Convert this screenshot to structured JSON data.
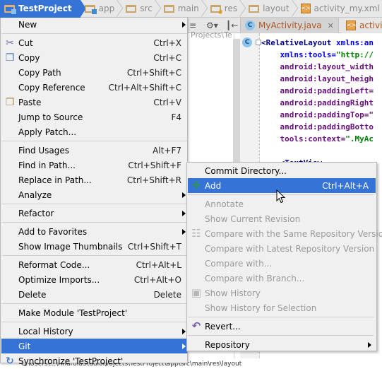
{
  "breadcrumb": [
    {
      "label": "TestProject",
      "icon": "module-folder-icon",
      "active": true
    },
    {
      "label": "app",
      "icon": "module-folder-icon"
    },
    {
      "label": "src",
      "icon": "folder-icon"
    },
    {
      "label": "main",
      "icon": "folder-icon"
    },
    {
      "label": "res",
      "icon": "resource-folder-icon"
    },
    {
      "label": "layout",
      "icon": "layout-folder-icon"
    },
    {
      "label": "activity_my.xml",
      "icon": "xml-file-icon"
    }
  ],
  "editor": {
    "tabs": [
      {
        "label": "MyActivity.java",
        "icon": "java-class-icon",
        "closable": true
      },
      {
        "label": "activity",
        "icon": "xml-file-icon"
      }
    ],
    "project_path": "Projects\\Te",
    "code_lines": [
      [
        {
          "t": "<RelativeLayout ",
          "c": "tagc"
        },
        {
          "t": "xmlns:an",
          "c": "attrb"
        }
      ],
      [
        {
          "t": "    xmlns:tools=",
          "c": "attrb"
        },
        {
          "t": "\"http://",
          "c": "str"
        }
      ],
      [
        {
          "t": "    android:layout_width",
          "c": "attr"
        }
      ],
      [
        {
          "t": "    android:layout_heigh",
          "c": "attr"
        }
      ],
      [
        {
          "t": "    android:paddingLeft=",
          "c": "attr"
        }
      ],
      [
        {
          "t": "    android:paddingRight",
          "c": "attr"
        }
      ],
      [
        {
          "t": "    android:paddingTop=\"",
          "c": "attr"
        }
      ],
      [
        {
          "t": "    android:paddingBotto",
          "c": "attr"
        }
      ],
      [
        {
          "t": "    tools:context=",
          "c": "attr"
        },
        {
          "t": "\".MyAc",
          "c": "str"
        }
      ],
      [
        {
          "t": "",
          "c": ""
        }
      ],
      [
        {
          "t": "    <TextView",
          "c": "tagc"
        }
      ]
    ]
  },
  "context_menu": {
    "items": [
      {
        "label": "New",
        "submenu": true
      },
      {
        "sep": true
      },
      {
        "label": "Cut",
        "shortcut": "Ctrl+X",
        "icon": "scissors-icon"
      },
      {
        "label": "Copy",
        "shortcut": "Ctrl+C",
        "icon": "copy-icon"
      },
      {
        "label": "Copy Path",
        "shortcut": "Ctrl+Shift+C"
      },
      {
        "label": "Copy Reference",
        "shortcut": "Ctrl+Alt+Shift+C"
      },
      {
        "label": "Paste",
        "shortcut": "Ctrl+V",
        "icon": "paste-icon"
      },
      {
        "label": "Jump to Source",
        "shortcut": "F4"
      },
      {
        "label": "Apply Patch..."
      },
      {
        "sep": true
      },
      {
        "label": "Find Usages",
        "shortcut": "Alt+F7"
      },
      {
        "label": "Find in Path...",
        "shortcut": "Ctrl+Shift+F"
      },
      {
        "label": "Replace in Path...",
        "shortcut": "Ctrl+Shift+R"
      },
      {
        "label": "Analyze",
        "submenu": true
      },
      {
        "sep": true
      },
      {
        "label": "Refactor",
        "submenu": true
      },
      {
        "sep": true
      },
      {
        "label": "Add to Favorites",
        "submenu": true
      },
      {
        "label": "Show Image Thumbnails",
        "shortcut": "Ctrl+Shift+T"
      },
      {
        "sep": true
      },
      {
        "label": "Reformat Code...",
        "shortcut": "Ctrl+Alt+L"
      },
      {
        "label": "Optimize Imports...",
        "shortcut": "Ctrl+Alt+O"
      },
      {
        "label": "Delete",
        "shortcut": "Delete"
      },
      {
        "sep": true
      },
      {
        "label": "Make Module 'TestProject'"
      },
      {
        "sep": true
      },
      {
        "label": "Local History",
        "submenu": true
      },
      {
        "label": "Git",
        "submenu": true,
        "selected": true
      },
      {
        "label": "Synchronize 'TestProject'",
        "icon": "synchronize-icon"
      }
    ]
  },
  "git_submenu": {
    "items": [
      {
        "label": "Commit Directory..."
      },
      {
        "label": "Add",
        "shortcut": "Ctrl+Alt+A",
        "icon": "plus-icon",
        "selected": true
      },
      {
        "sep": true
      },
      {
        "label": "Annotate",
        "disabled": true
      },
      {
        "label": "Show Current Revision",
        "disabled": true
      },
      {
        "label": "Compare with the Same Repository Version",
        "disabled": true,
        "icon": "compare-icon"
      },
      {
        "label": "Compare with Latest Repository Version",
        "disabled": true
      },
      {
        "label": "Compare with...",
        "disabled": true
      },
      {
        "label": "Compare with Branch...",
        "disabled": true
      },
      {
        "label": "Show History",
        "disabled": true,
        "icon": "history-icon"
      },
      {
        "label": "Show History for Selection",
        "disabled": true
      },
      {
        "sep": true
      },
      {
        "label": "Revert...",
        "icon": "revert-icon"
      },
      {
        "sep": true
      },
      {
        "label": "Repository",
        "submenu": true
      }
    ]
  },
  "status_line": "C:\\Users\\...\\AndroidStudioProjects\\TestProject\\app\\src\\main\\res\\layout",
  "colors": {
    "selection": "#3574d6",
    "menu_bg": "#f0f0f0",
    "disabled_text": "#9a9a9a"
  }
}
